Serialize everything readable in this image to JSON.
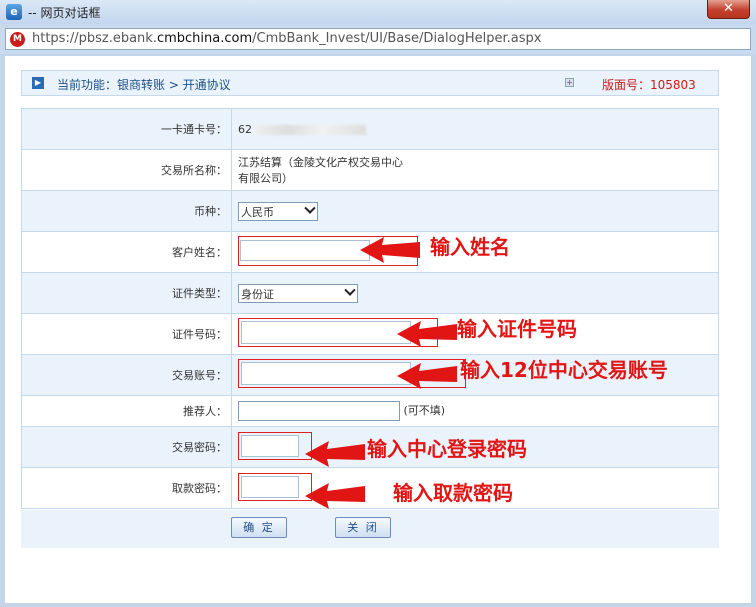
{
  "window": {
    "title": "-- 网页对话框",
    "close": "✕"
  },
  "address": {
    "url_prefix": "https://pbsz.ebank.",
    "url_domain": "cmbchina.com",
    "url_path": "/CmbBank_Invest/UI/Base/DialogHelper.aspx"
  },
  "func": {
    "text": "当前功能：银商转账 > 开通协议",
    "version": "版面号：105803"
  },
  "form": {
    "card_label": "一卡通卡号：",
    "card_value": "62",
    "exchange_label": "交易所名称：",
    "exchange_value_1": "江苏结算（金陵文化产权交易中心",
    "exchange_value_2": "有限公司）",
    "currency_label": "币种：",
    "currency_value": "人民币",
    "name_label": "客户姓名：",
    "idtype_label": "证件类型：",
    "idtype_value": "身份证",
    "idno_label": "证件号码：",
    "account_label": "交易账号：",
    "referrer_label": "推荐人：",
    "referrer_hint": "(可不填)",
    "tradepwd_label": "交易密码：",
    "withdrawpwd_label": "取款密码："
  },
  "buttons": {
    "ok": "确 定",
    "close": "关 闭"
  },
  "annotations": {
    "name": "输入姓名",
    "idno": "输入证件号码",
    "account": "输入12位中心交易账号",
    "tradepwd": "输入中心登录密码",
    "withdrawpwd": "输入取款密码"
  },
  "colors": {
    "annotation": "#e21515",
    "version": "#cc1b1b",
    "border": "#c5d9ec"
  }
}
